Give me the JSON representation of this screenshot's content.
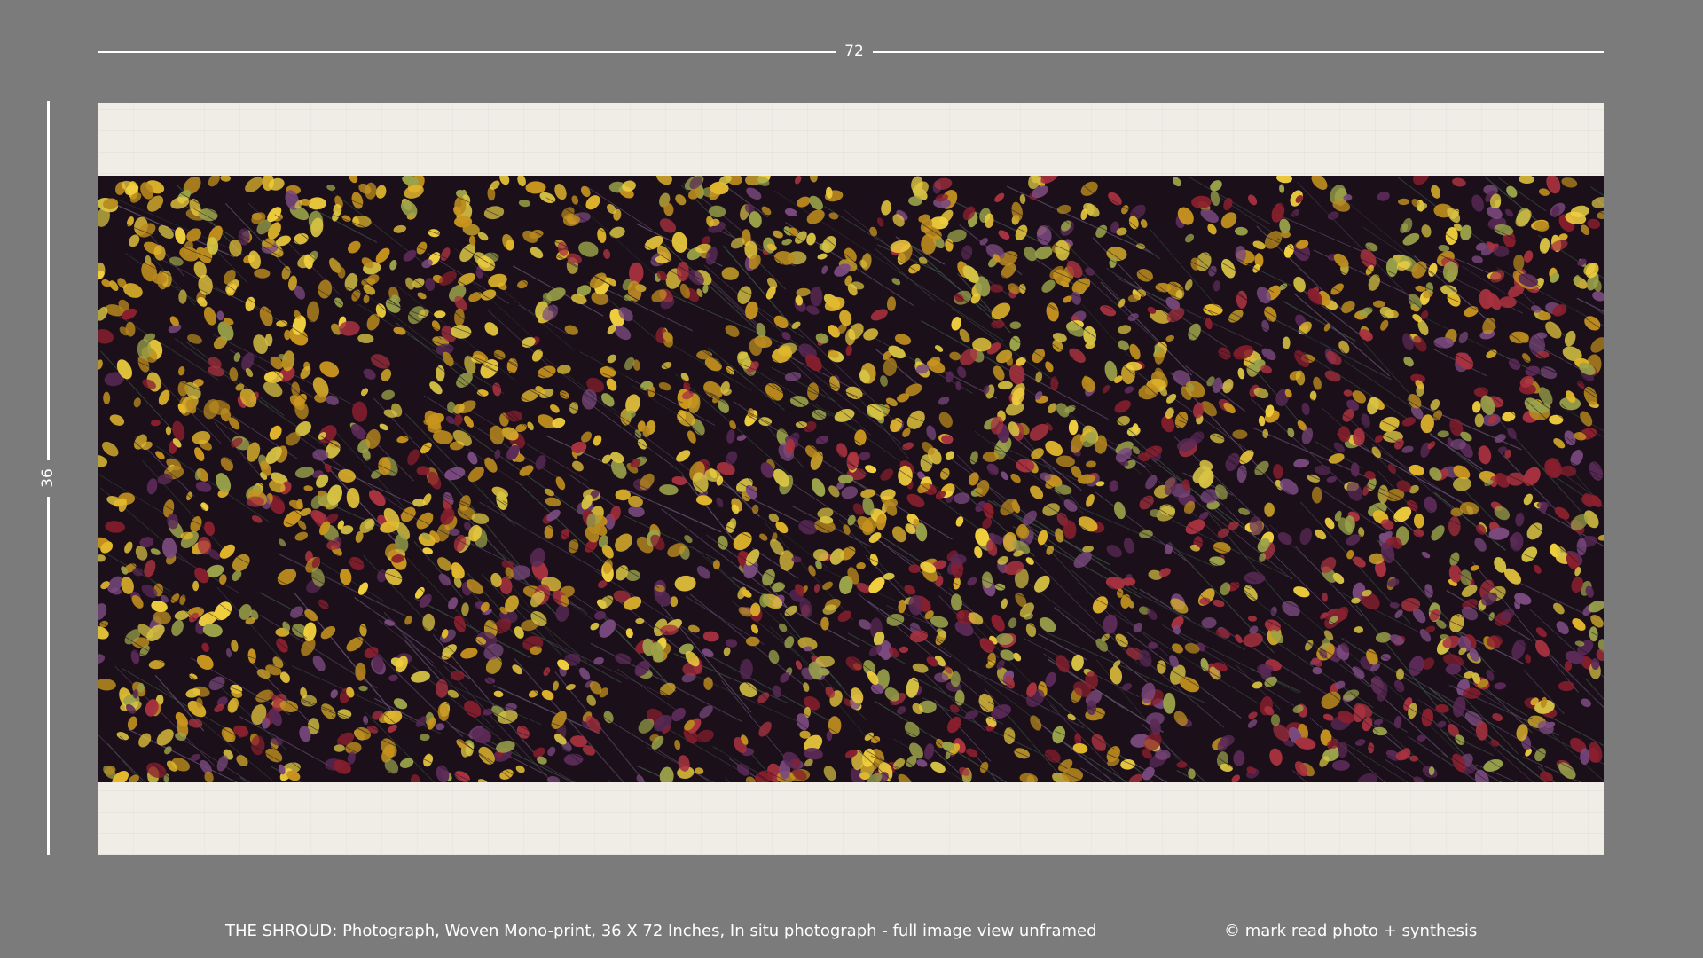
{
  "dimensions": {
    "width_label": "72",
    "height_label": "36"
  },
  "artwork": {
    "band_color": "#1b0f1a",
    "mat_color": "#efede6",
    "leaf_palette": [
      "#e2b72c",
      "#f0cf3e",
      "#c9951f",
      "#b98a1e",
      "#8a1f2e",
      "#a8323f",
      "#5b2a57",
      "#7a4a7e",
      "#9aa24a",
      "#d6c243"
    ]
  },
  "caption": {
    "title": "THE SHROUD: Photograph, Woven Mono-print, 36 X 72 Inches, In situ photograph - full image view unframed",
    "credit": "©  mark read photo + synthesis"
  },
  "colors": {
    "background": "#7b7b7b",
    "text": "#ffffff"
  }
}
